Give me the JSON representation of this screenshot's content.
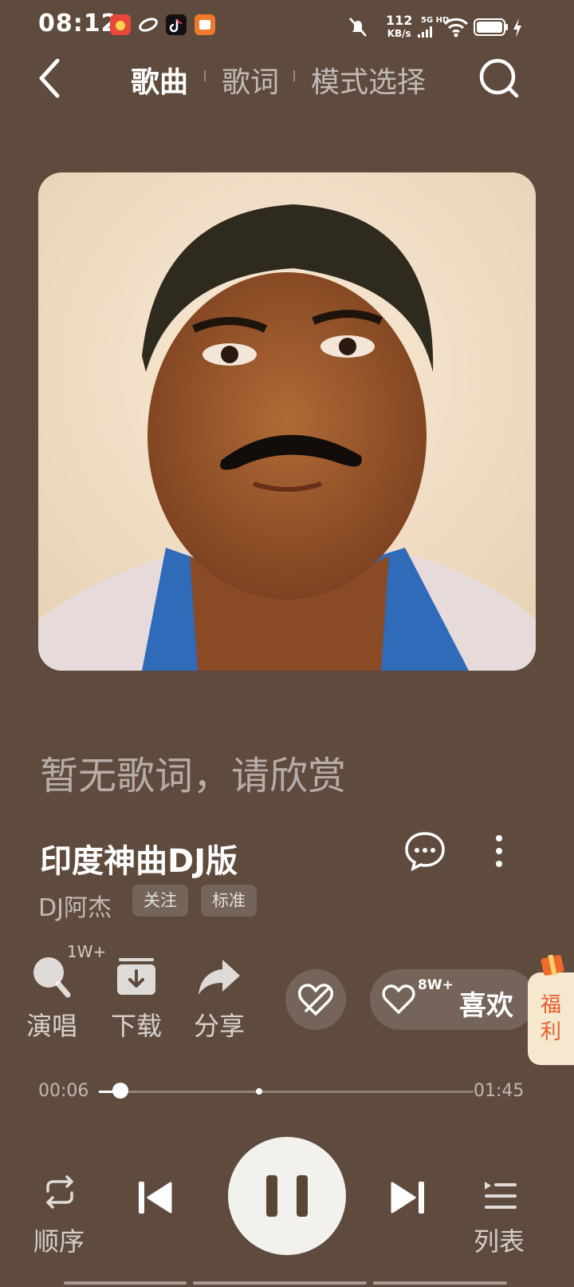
{
  "status_bar": {
    "time": "08:12",
    "net_speed_value": "112",
    "net_speed_unit": "KB/s",
    "network_type": "5G HD",
    "icons": [
      "app-icon-red",
      "app-icon-link",
      "tiktok-icon",
      "app-icon-orange",
      "mute-icon",
      "signal-icon",
      "wifi-icon",
      "battery-icon",
      "charging-icon"
    ]
  },
  "nav": {
    "tabs": [
      {
        "label": "歌曲",
        "active": true
      },
      {
        "label": "歌词",
        "active": false
      },
      {
        "label": "模式选择",
        "active": false
      }
    ]
  },
  "lyrics_placeholder": "暂无歌词，请欣赏",
  "song": {
    "title": "印度神曲DJ版",
    "artist": "DJ阿杰",
    "follow_label": "关注",
    "quality_label": "标准"
  },
  "actions": {
    "sing_label": "演唱",
    "sing_badge": "1W+",
    "download_label": "下载",
    "share_label": "分享",
    "like_count": "8W+",
    "like_label": "喜欢",
    "welfare_label_1": "福",
    "welfare_label_2": "利"
  },
  "progress": {
    "current": "00:06",
    "total": "01:45",
    "fraction": 0.057
  },
  "controls": {
    "repeat_label": "顺序",
    "playlist_label": "列表"
  },
  "colors": {
    "background": "#5f4b3e",
    "accent_orange": "#e85d2b",
    "welfare_bg": "#f5e8cf"
  }
}
